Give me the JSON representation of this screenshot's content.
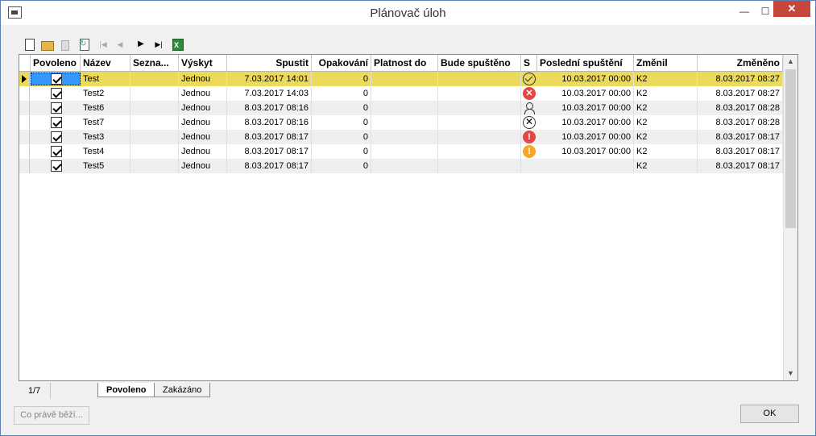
{
  "window": {
    "title": "Plánovač úloh",
    "minimize_glyph": "—",
    "maximize_glyph": "☐",
    "close_glyph": "✕"
  },
  "toolbar": {
    "icons": [
      "new-icon",
      "open-folder-icon",
      "delete-icon",
      "refresh-icon",
      "first-record-icon",
      "previous-record-icon",
      "next-record-icon",
      "last-record-icon",
      "excel-export-icon"
    ],
    "first_glyph": "|◀",
    "prev_glyph": "◀",
    "next_glyph": "▶",
    "last_glyph": "▶|"
  },
  "grid": {
    "columns": [
      "Povoleno",
      "Název",
      "Sezna...",
      "Výskyt",
      "Spustit",
      "Opakování",
      "Platnost do",
      "Bude spuštěno",
      "S",
      "Poslední spuštění",
      "Změnil",
      "Změněno"
    ],
    "rows": [
      {
        "name": "Test",
        "list": "",
        "occurrence": "Jednou",
        "start": "7.03.2017 14:01",
        "repeat": "0",
        "valid_to": "",
        "next_run": "",
        "status": "ok",
        "last_run": "10.03.2017 00:00",
        "changed_by": "K2",
        "changed": "8.03.2017 08:27"
      },
      {
        "name": "Test2",
        "list": "",
        "occurrence": "Jednou",
        "start": "7.03.2017 14:03",
        "repeat": "0",
        "valid_to": "",
        "next_run": "",
        "status": "error",
        "last_run": "10.03.2017 00:00",
        "changed_by": "K2",
        "changed": "8.03.2017 08:27"
      },
      {
        "name": "Test6",
        "list": "",
        "occurrence": "Jednou",
        "start": "8.03.2017 08:16",
        "repeat": "0",
        "valid_to": "",
        "next_run": "",
        "status": "user",
        "last_run": "10.03.2017 00:00",
        "changed_by": "K2",
        "changed": "8.03.2017 08:28"
      },
      {
        "name": "Test7",
        "list": "",
        "occurrence": "Jednou",
        "start": "8.03.2017 08:16",
        "repeat": "0",
        "valid_to": "",
        "next_run": "",
        "status": "cancelled",
        "last_run": "10.03.2017 00:00",
        "changed_by": "K2",
        "changed": "8.03.2017 08:28"
      },
      {
        "name": "Test3",
        "list": "",
        "occurrence": "Jednou",
        "start": "8.03.2017 08:17",
        "repeat": "0",
        "valid_to": "",
        "next_run": "",
        "status": "warning-red",
        "last_run": "10.03.2017 00:00",
        "changed_by": "K2",
        "changed": "8.03.2017 08:17"
      },
      {
        "name": "Test4",
        "list": "",
        "occurrence": "Jednou",
        "start": "8.03.2017 08:17",
        "repeat": "0",
        "valid_to": "",
        "next_run": "",
        "status": "warning-orange",
        "last_run": "10.03.2017 00:00",
        "changed_by": "K2",
        "changed": "8.03.2017 08:17"
      },
      {
        "name": "Test5",
        "list": "",
        "occurrence": "Jednou",
        "start": "8.03.2017 08:17",
        "repeat": "0",
        "valid_to": "",
        "next_run": "",
        "status": "none",
        "last_run": "",
        "changed_by": "K2",
        "changed": "8.03.2017 08:17"
      }
    ],
    "selected_color": "#ecdb5a",
    "scroll_up_glyph": "▲",
    "scroll_down_glyph": "▼"
  },
  "statusbar": {
    "counter": "1/7",
    "tabs": [
      "Povoleno",
      "Zakázáno"
    ]
  },
  "buttons": {
    "running": "Co právě běží...",
    "ok": "OK"
  },
  "status_glyphs": {
    "error": "✕",
    "cancelled": "✕",
    "warning-red": "!",
    "warning-orange": "!"
  }
}
